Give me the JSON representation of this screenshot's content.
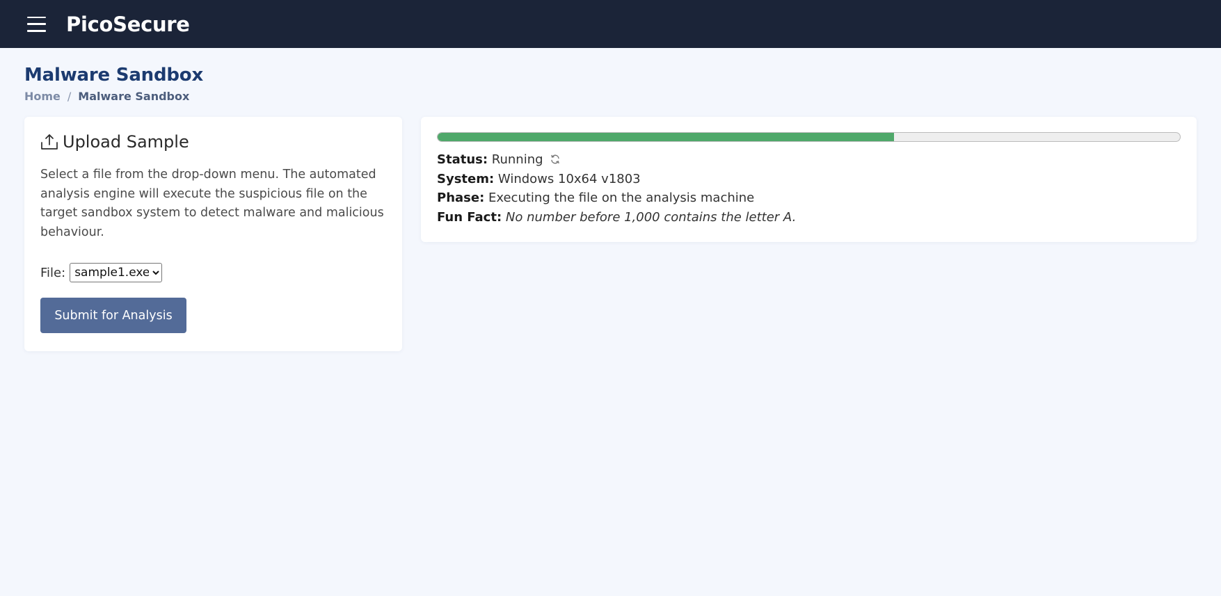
{
  "header": {
    "brand": "PicoSecure"
  },
  "page": {
    "title": "Malware Sandbox",
    "breadcrumb": {
      "home": "Home",
      "separator": "/",
      "current": "Malware Sandbox"
    }
  },
  "upload": {
    "title": "Upload Sample",
    "description": "Select a file from the drop-down menu. The automated analysis engine will execute the suspicious file on the target sandbox system to detect malware and malicious behaviour.",
    "file_label": "File:",
    "selected_file": "sample1.exe",
    "submit_label": "Submit for Analysis"
  },
  "analysis": {
    "progress_percent": 61.5,
    "status_label": "Status:",
    "status_value": "Running",
    "system_label": "System:",
    "system_value": "Windows 10x64 v1803",
    "phase_label": "Phase:",
    "phase_value": "Executing the file on the analysis machine",
    "fact_label": "Fun Fact:",
    "fact_value": "No number before 1,000 contains the letter A."
  },
  "colors": {
    "topbar": "#1b2438",
    "title": "#1c3b70",
    "button": "#536b98",
    "progress": "#4fa86a"
  }
}
